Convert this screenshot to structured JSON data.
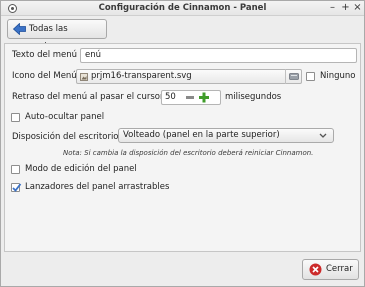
{
  "window": {
    "title": "Configuración de Cinnamon - Panel",
    "minimize_glyph": "–",
    "maximize_glyph": "+",
    "close_glyph": "×"
  },
  "toolbar": {
    "back_label": "Todas las opciones"
  },
  "settings": {
    "menu_text_label": "Texto del menú",
    "menu_text_value": "enú",
    "menu_icon_label": "Icono del Menú",
    "menu_icon_file": "prjm16-transparent.svg",
    "none_label": "Ninguno",
    "none_checked": false,
    "delay_label": "Retraso del menú al pasar el cursor",
    "delay_value": "50",
    "delay_unit": "milisegundos",
    "autohide_label": "Auto-ocultar panel",
    "autohide_checked": false,
    "layout_label": "Disposición del escritorio",
    "layout_value": "Volteado (panel en la parte superior)",
    "layout_note": "Nota: Si cambia la disposición del escritorio deberá reiniciar Cinnamon.",
    "edit_mode_label": "Modo de edición del panel",
    "edit_mode_checked": false,
    "draggable_label": "Lanzadores del panel arrastrables",
    "draggable_checked": true
  },
  "footer": {
    "close_label": "Cerrar"
  },
  "colors": {
    "accent_blue": "#3b72c6",
    "plus_green": "#3f9c2a",
    "close_red": "#cc2a2a"
  }
}
